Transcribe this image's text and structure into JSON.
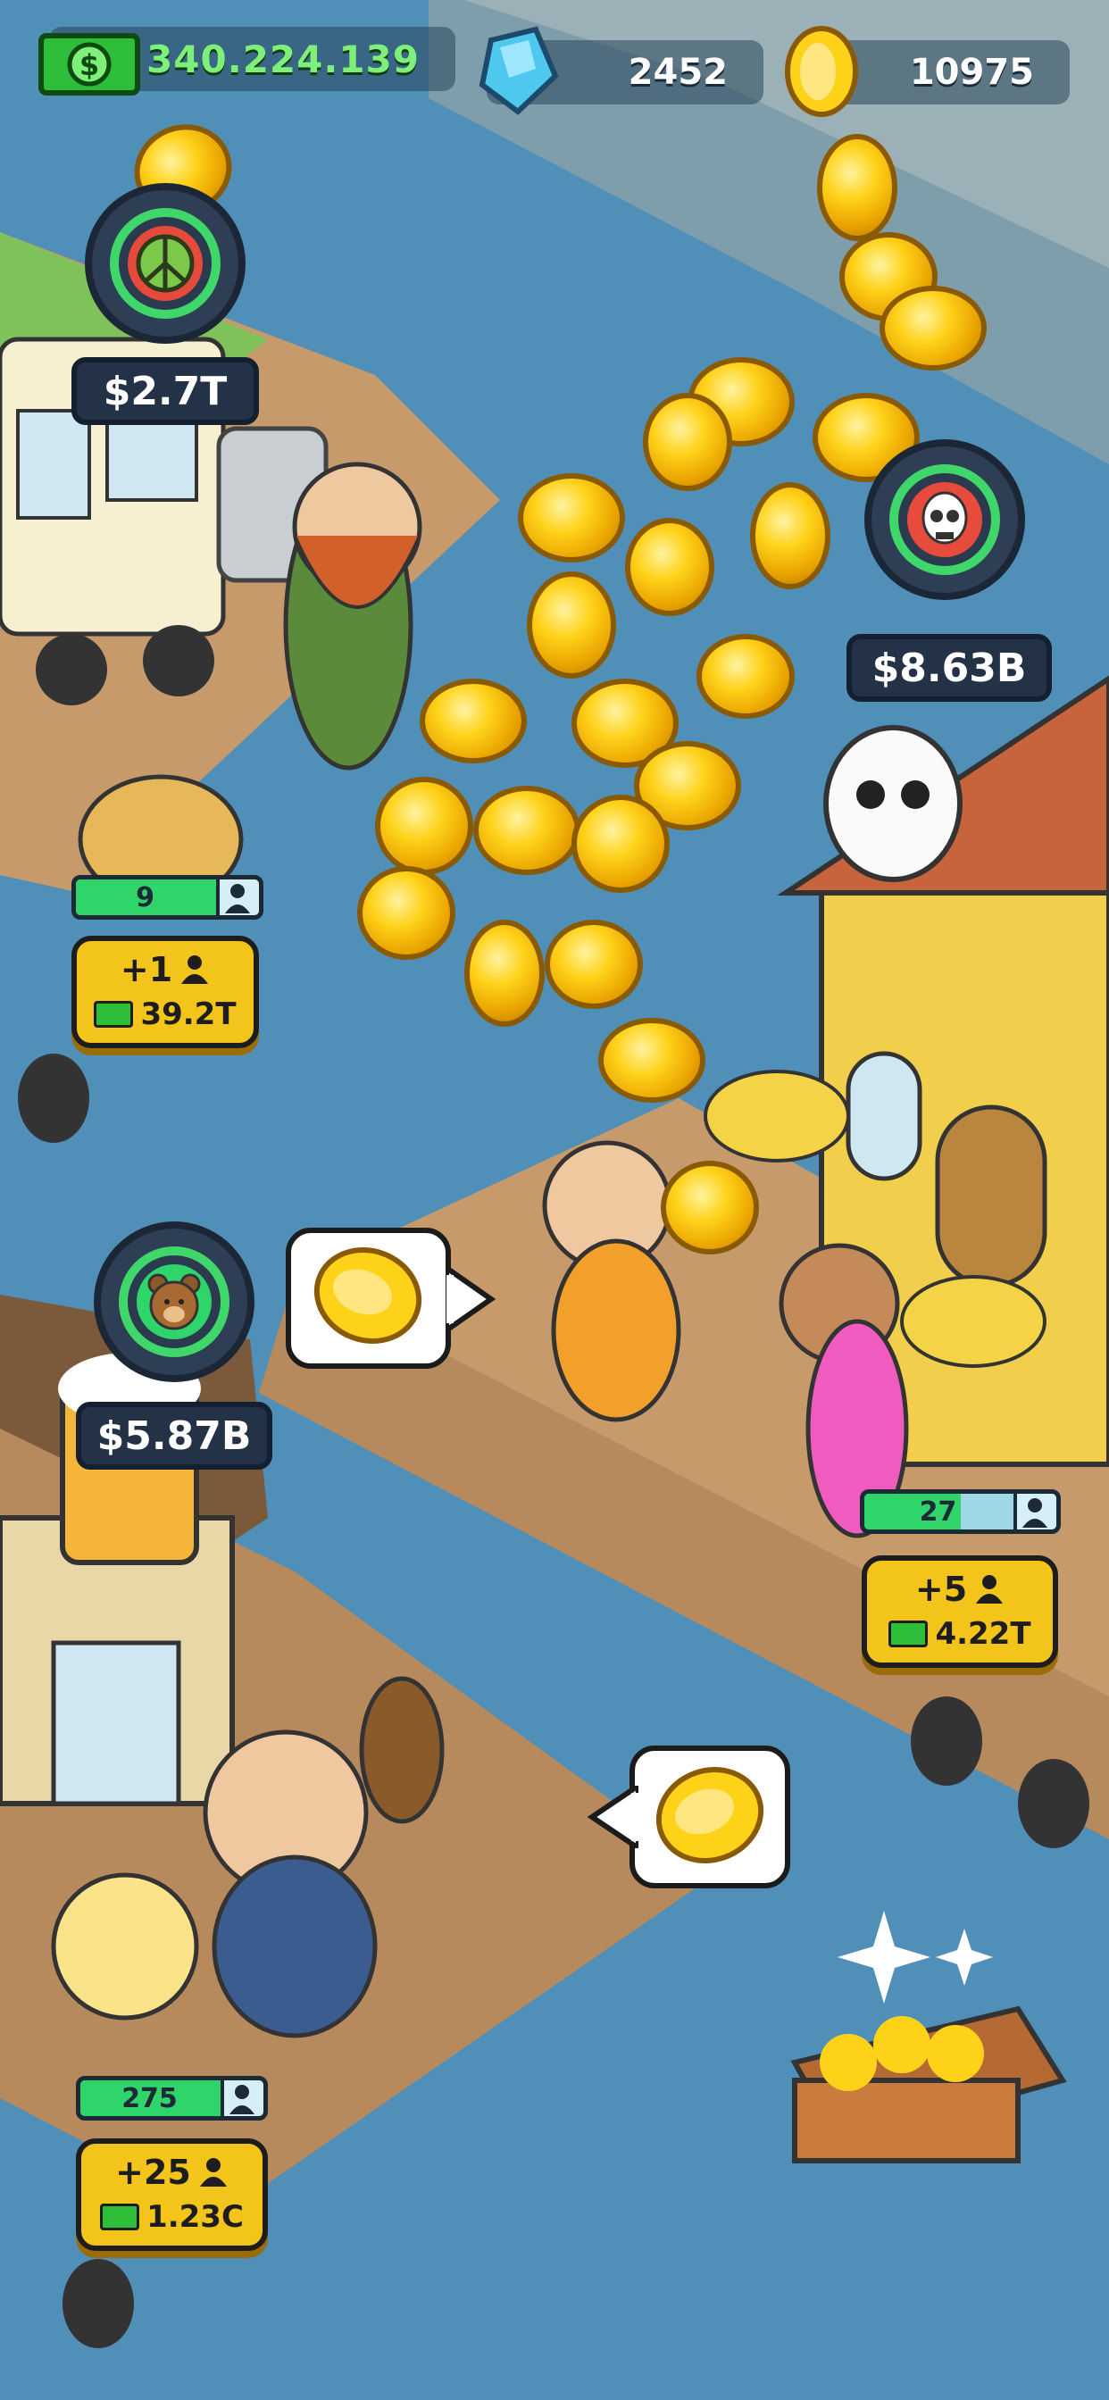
{
  "hud": {
    "money": "340.224.139",
    "gems": "2452",
    "coins": "10975"
  },
  "venues": [
    {
      "id": "hippie",
      "price": "$2.7T",
      "staff_count": "9",
      "hire_amount": "+1",
      "hire_cost": "39.2T",
      "staff_fill": 0.8
    },
    {
      "id": "mexican",
      "price": "$8.63B",
      "staff_count": "27",
      "hire_amount": "+5",
      "hire_cost": "4.22T",
      "staff_fill": 0.5
    },
    {
      "id": "lumberjack",
      "price": "$5.87B",
      "staff_count": "275",
      "hire_amount": "+25",
      "hire_cost": "1.23C",
      "staff_fill": 0.85
    }
  ],
  "icons": {
    "money": "cash-bill-icon",
    "gem": "blue-gem-icon",
    "coin": "gold-coin-icon",
    "hippie": "peace-sign-icon",
    "mexican": "sugar-skull-icon",
    "lumberjack": "bear-icon",
    "person": "person-icon",
    "chest": "treasure-chest-icon"
  },
  "colors": {
    "water": "#4f8fb8",
    "money_text": "#7ef07a",
    "button": "#f3c41a",
    "progress": "#2fd46a"
  }
}
